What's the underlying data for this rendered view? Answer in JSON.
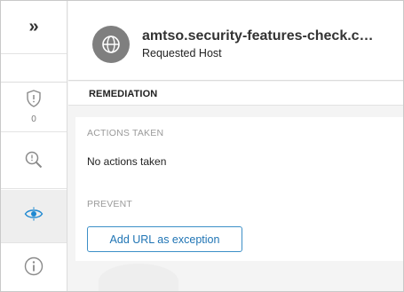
{
  "rail": {
    "expand_glyph": "»",
    "shield_count": "0",
    "icons": [
      "expand-icon",
      "shield-alert-icon",
      "search-icon",
      "threat-eye-icon",
      "info-icon"
    ]
  },
  "header": {
    "host": "amtso.security-features-check.c…",
    "subtitle": "Requested Host",
    "icon": "globe-icon"
  },
  "remediation": {
    "title": "REMEDIATION",
    "actions_label": "ACTIONS TAKEN",
    "actions_value": "No actions taken",
    "prevent_label": "PREVENT",
    "add_button": "Add URL as exception"
  },
  "colors": {
    "accent": "#1f74b4",
    "active_icon": "#1e88d1",
    "icon_gray": "#8a8a8a"
  }
}
